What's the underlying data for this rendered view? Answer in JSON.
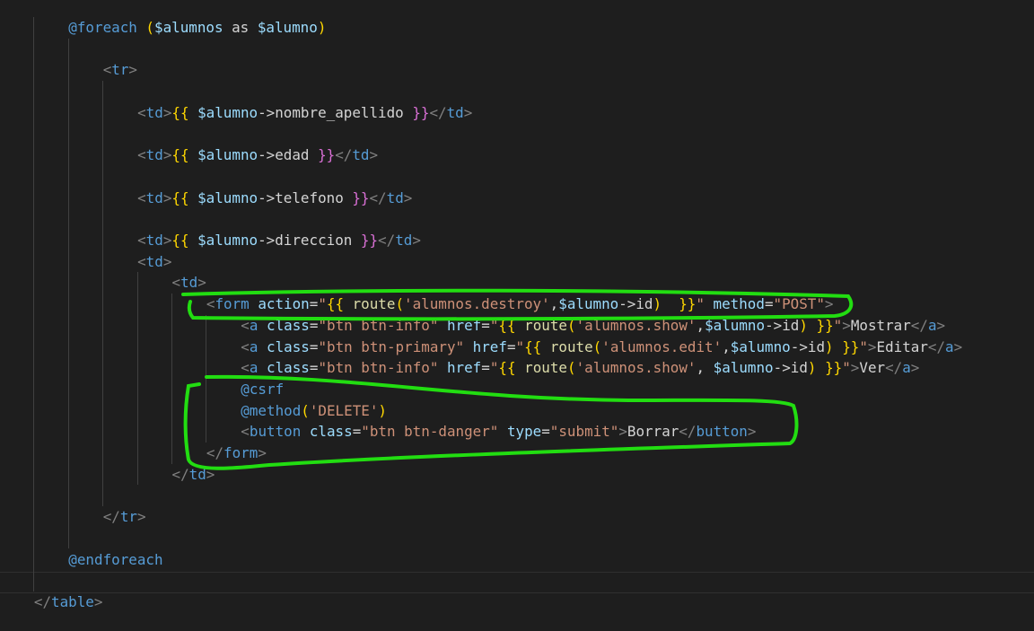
{
  "lines": [
    {
      "n": 0,
      "indent": 8,
      "tokens": [
        [
          "k",
          "@foreach"
        ],
        [
          "w",
          " "
        ],
        [
          "y",
          "("
        ],
        [
          "v",
          "$alumnos"
        ],
        [
          "w",
          " as "
        ],
        [
          "v",
          "$alumno"
        ],
        [
          "y",
          ")"
        ]
      ]
    },
    {
      "n": 2,
      "indent": 12,
      "tokens": [
        [
          "p",
          "<"
        ],
        [
          "t",
          "tr"
        ],
        [
          "p",
          ">"
        ]
      ]
    },
    {
      "n": 4,
      "indent": 16,
      "tokens": [
        [
          "p",
          "<"
        ],
        [
          "t",
          "td"
        ],
        [
          "p",
          ">"
        ],
        [
          "y",
          "{{"
        ],
        [
          "w",
          " "
        ],
        [
          "v",
          "$alumno"
        ],
        [
          "w",
          "->nombre_apellido "
        ],
        [
          "m",
          "}}"
        ],
        [
          "p",
          "</"
        ],
        [
          "t",
          "td"
        ],
        [
          "p",
          ">"
        ]
      ]
    },
    {
      "n": 6,
      "indent": 16,
      "tokens": [
        [
          "p",
          "<"
        ],
        [
          "t",
          "td"
        ],
        [
          "p",
          ">"
        ],
        [
          "y",
          "{{"
        ],
        [
          "w",
          " "
        ],
        [
          "v",
          "$alumno"
        ],
        [
          "w",
          "->edad "
        ],
        [
          "m",
          "}}"
        ],
        [
          "p",
          "</"
        ],
        [
          "t",
          "td"
        ],
        [
          "p",
          ">"
        ]
      ]
    },
    {
      "n": 8,
      "indent": 16,
      "tokens": [
        [
          "p",
          "<"
        ],
        [
          "t",
          "td"
        ],
        [
          "p",
          ">"
        ],
        [
          "y",
          "{{"
        ],
        [
          "w",
          " "
        ],
        [
          "v",
          "$alumno"
        ],
        [
          "w",
          "->telefono "
        ],
        [
          "m",
          "}}"
        ],
        [
          "p",
          "</"
        ],
        [
          "t",
          "td"
        ],
        [
          "p",
          ">"
        ]
      ]
    },
    {
      "n": 10,
      "indent": 16,
      "tokens": [
        [
          "p",
          "<"
        ],
        [
          "t",
          "td"
        ],
        [
          "p",
          ">"
        ],
        [
          "y",
          "{{"
        ],
        [
          "w",
          " "
        ],
        [
          "v",
          "$alumno"
        ],
        [
          "w",
          "->direccion "
        ],
        [
          "m",
          "}}"
        ],
        [
          "p",
          "</"
        ],
        [
          "t",
          "td"
        ],
        [
          "p",
          ">"
        ]
      ]
    },
    {
      "n": 11,
      "indent": 16,
      "tokens": [
        [
          "p",
          "<"
        ],
        [
          "t",
          "td"
        ],
        [
          "p",
          ">"
        ]
      ]
    },
    {
      "n": 12,
      "indent": 20,
      "tokens": [
        [
          "p",
          "<"
        ],
        [
          "t",
          "td"
        ],
        [
          "p",
          ">"
        ]
      ]
    },
    {
      "n": 13,
      "indent": 24,
      "tokens": [
        [
          "p",
          "<"
        ],
        [
          "t",
          "form"
        ],
        [
          "w",
          " "
        ],
        [
          "a",
          "action"
        ],
        [
          "w",
          "="
        ],
        [
          "s",
          "\""
        ],
        [
          "y",
          "{{"
        ],
        [
          "w",
          " "
        ],
        [
          "f",
          "route"
        ],
        [
          "y",
          "("
        ],
        [
          "s",
          "'alumnos.destroy'"
        ],
        [
          "w",
          ","
        ],
        [
          "v",
          "$alumno"
        ],
        [
          "w",
          "->id"
        ],
        [
          "y",
          ")"
        ],
        [
          "w",
          "  "
        ],
        [
          "y",
          "}}"
        ],
        [
          "s",
          "\""
        ],
        [
          "w",
          " "
        ],
        [
          "a",
          "method"
        ],
        [
          "w",
          "="
        ],
        [
          "s",
          "\"POST\""
        ],
        [
          "p",
          ">"
        ]
      ]
    },
    {
      "n": 14,
      "indent": 28,
      "tokens": [
        [
          "p",
          "<"
        ],
        [
          "t",
          "a"
        ],
        [
          "w",
          " "
        ],
        [
          "a",
          "class"
        ],
        [
          "w",
          "="
        ],
        [
          "s",
          "\"btn btn-info\""
        ],
        [
          "w",
          " "
        ],
        [
          "a",
          "href"
        ],
        [
          "w",
          "="
        ],
        [
          "s",
          "\""
        ],
        [
          "y",
          "{{"
        ],
        [
          "w",
          " "
        ],
        [
          "f",
          "route"
        ],
        [
          "y",
          "("
        ],
        [
          "s",
          "'alumnos.show'"
        ],
        [
          "w",
          ","
        ],
        [
          "v",
          "$alumno"
        ],
        [
          "w",
          "->id"
        ],
        [
          "y",
          ")"
        ],
        [
          "w",
          " "
        ],
        [
          "y",
          "}}"
        ],
        [
          "s",
          "\""
        ],
        [
          "p",
          ">"
        ],
        [
          "w",
          "Mostrar"
        ],
        [
          "p",
          "</"
        ],
        [
          "t",
          "a"
        ],
        [
          "p",
          ">"
        ]
      ]
    },
    {
      "n": 15,
      "indent": 28,
      "tokens": [
        [
          "p",
          "<"
        ],
        [
          "t",
          "a"
        ],
        [
          "w",
          " "
        ],
        [
          "a",
          "class"
        ],
        [
          "w",
          "="
        ],
        [
          "s",
          "\"btn btn-primary\""
        ],
        [
          "w",
          " "
        ],
        [
          "a",
          "href"
        ],
        [
          "w",
          "="
        ],
        [
          "s",
          "\""
        ],
        [
          "y",
          "{{"
        ],
        [
          "w",
          " "
        ],
        [
          "f",
          "route"
        ],
        [
          "y",
          "("
        ],
        [
          "s",
          "'alumnos.edit'"
        ],
        [
          "w",
          ","
        ],
        [
          "v",
          "$alumno"
        ],
        [
          "w",
          "->id"
        ],
        [
          "y",
          ")"
        ],
        [
          "w",
          " "
        ],
        [
          "y",
          "}}"
        ],
        [
          "s",
          "\""
        ],
        [
          "p",
          ">"
        ],
        [
          "w",
          "Editar"
        ],
        [
          "p",
          "</"
        ],
        [
          "t",
          "a"
        ],
        [
          "p",
          ">"
        ]
      ]
    },
    {
      "n": 16,
      "indent": 28,
      "tokens": [
        [
          "p",
          "<"
        ],
        [
          "t",
          "a"
        ],
        [
          "w",
          " "
        ],
        [
          "a",
          "class"
        ],
        [
          "w",
          "="
        ],
        [
          "s",
          "\"btn btn-info\""
        ],
        [
          "w",
          " "
        ],
        [
          "a",
          "href"
        ],
        [
          "w",
          "="
        ],
        [
          "s",
          "\""
        ],
        [
          "y",
          "{{"
        ],
        [
          "w",
          " "
        ],
        [
          "f",
          "route"
        ],
        [
          "y",
          "("
        ],
        [
          "s",
          "'alumnos.show'"
        ],
        [
          "w",
          ", "
        ],
        [
          "v",
          "$alumno"
        ],
        [
          "w",
          "->id"
        ],
        [
          "y",
          ")"
        ],
        [
          "w",
          " "
        ],
        [
          "y",
          "}}"
        ],
        [
          "s",
          "\""
        ],
        [
          "p",
          ">"
        ],
        [
          "w",
          "Ver"
        ],
        [
          "p",
          "</"
        ],
        [
          "t",
          "a"
        ],
        [
          "p",
          ">"
        ]
      ]
    },
    {
      "n": 17,
      "indent": 28,
      "tokens": [
        [
          "k",
          "@csrf"
        ]
      ]
    },
    {
      "n": 18,
      "indent": 28,
      "tokens": [
        [
          "k",
          "@method"
        ],
        [
          "y",
          "("
        ],
        [
          "s",
          "'DELETE'"
        ],
        [
          "y",
          ")"
        ]
      ]
    },
    {
      "n": 19,
      "indent": 28,
      "tokens": [
        [
          "p",
          "<"
        ],
        [
          "t",
          "button"
        ],
        [
          "w",
          " "
        ],
        [
          "a",
          "class"
        ],
        [
          "w",
          "="
        ],
        [
          "s",
          "\"btn btn-danger\""
        ],
        [
          "w",
          " "
        ],
        [
          "a",
          "type"
        ],
        [
          "w",
          "="
        ],
        [
          "s",
          "\"submit\""
        ],
        [
          "p",
          ">"
        ],
        [
          "w",
          "Borrar"
        ],
        [
          "p",
          "</"
        ],
        [
          "t",
          "button"
        ],
        [
          "p",
          ">"
        ]
      ]
    },
    {
      "n": 20,
      "indent": 24,
      "tokens": [
        [
          "p",
          "</"
        ],
        [
          "t",
          "form"
        ],
        [
          "p",
          ">"
        ]
      ]
    },
    {
      "n": 21,
      "indent": 20,
      "tokens": [
        [
          "p",
          "</"
        ],
        [
          "t",
          "td"
        ],
        [
          "p",
          ">"
        ]
      ]
    },
    {
      "n": 23,
      "indent": 12,
      "tokens": [
        [
          "p",
          "</"
        ],
        [
          "t",
          "tr"
        ],
        [
          "p",
          ">"
        ]
      ]
    },
    {
      "n": 25,
      "indent": 8,
      "tokens": [
        [
          "k",
          "@endforeach"
        ]
      ]
    },
    {
      "n": 27,
      "indent": 4,
      "tokens": [
        [
          "p",
          "</"
        ],
        [
          "t",
          "table"
        ],
        [
          "p",
          ">"
        ]
      ]
    }
  ],
  "annotation_color": "#22dd11"
}
